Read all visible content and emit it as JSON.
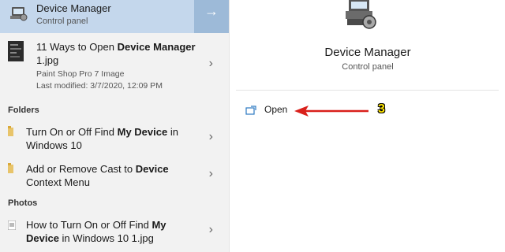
{
  "results": {
    "top": {
      "title": "Device Manager",
      "subtitle": "Control panel",
      "arrow": "→"
    },
    "file": {
      "title_pre": "11 Ways to Open ",
      "title_bold": "Device Manager",
      "title_line2": "1.jpg",
      "type": "Paint Shop Pro 7 Image",
      "modified": "Last modified: 3/7/2020, 12:09 PM"
    },
    "folders_header": "Folders",
    "folders": [
      {
        "line1_pre": "Turn On or Off Find ",
        "line1_bold": "My Device",
        "line1_post": " in",
        "line2_pre": "Windows 10",
        "line2_bold": "",
        "line2_post": ""
      },
      {
        "line1_pre": "Add or Remove Cast to ",
        "line1_bold": "Device",
        "line1_post": "",
        "line2_pre": "Context Menu",
        "line2_bold": "",
        "line2_post": ""
      }
    ],
    "photos_header": "Photos",
    "photos": [
      {
        "line1_pre": "How to Turn On or Off Find ",
        "line1_bold": "My",
        "line1_post": "",
        "line2_pre": "",
        "line2_bold": "Device",
        "line2_post": " in Windows 10 1.jpg"
      }
    ]
  },
  "detail": {
    "title": "Device Manager",
    "subtitle": "Control panel",
    "open_label": "Open",
    "annotation": "3"
  },
  "colors": {
    "accent": "#c4d7ec",
    "annotation_arrow": "#d9201b",
    "badge": "#ffe600"
  },
  "icons": {
    "device_manager": "device-manager-icon",
    "chevron": "chevron-right-icon"
  }
}
